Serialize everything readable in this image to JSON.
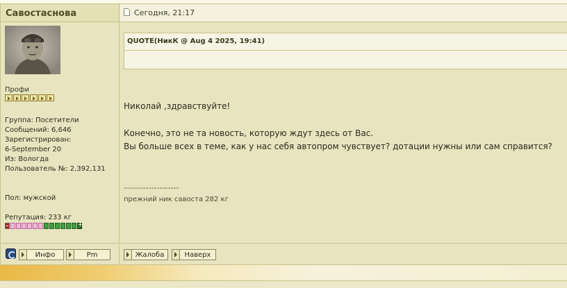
{
  "post": {
    "author": "Савостаснова",
    "date": "Сегодня, 21:17"
  },
  "profile": {
    "rank": "Профи",
    "rank_pips": 6,
    "group": "Группа: Посетители",
    "posts": "Сообщений: 6,646",
    "registered_label": "Зарегистрирован:",
    "registered_date": "6-September 20",
    "from": "Из: Вологда",
    "user_no": "Пользователь №: 2,392,131",
    "gender": "Пол: мужской",
    "reputation": "Репутация: 233 кг",
    "reputation_bar": {
      "negative": 6,
      "positive": 6
    }
  },
  "quote": {
    "header": "QUOTE(НикК @ Aug 4 2025, 19:41)",
    "body": ""
  },
  "message": {
    "greeting": "Николай ,здравствуйте!",
    "line1": "Конечно, это не та новость, которую ждут здесь от Вас.",
    "line2": "Вы больше всех в теме, как у нас себя автопром чувствует? дотации нужны или сам справится?"
  },
  "signature": {
    "separator": "--------------------",
    "text": "прежний ник савоста 282 кг"
  },
  "footer": {
    "info_label": "Инфо",
    "pm_label": "Pm",
    "report_label": "Жалоба",
    "top_label": "Наверх"
  }
}
